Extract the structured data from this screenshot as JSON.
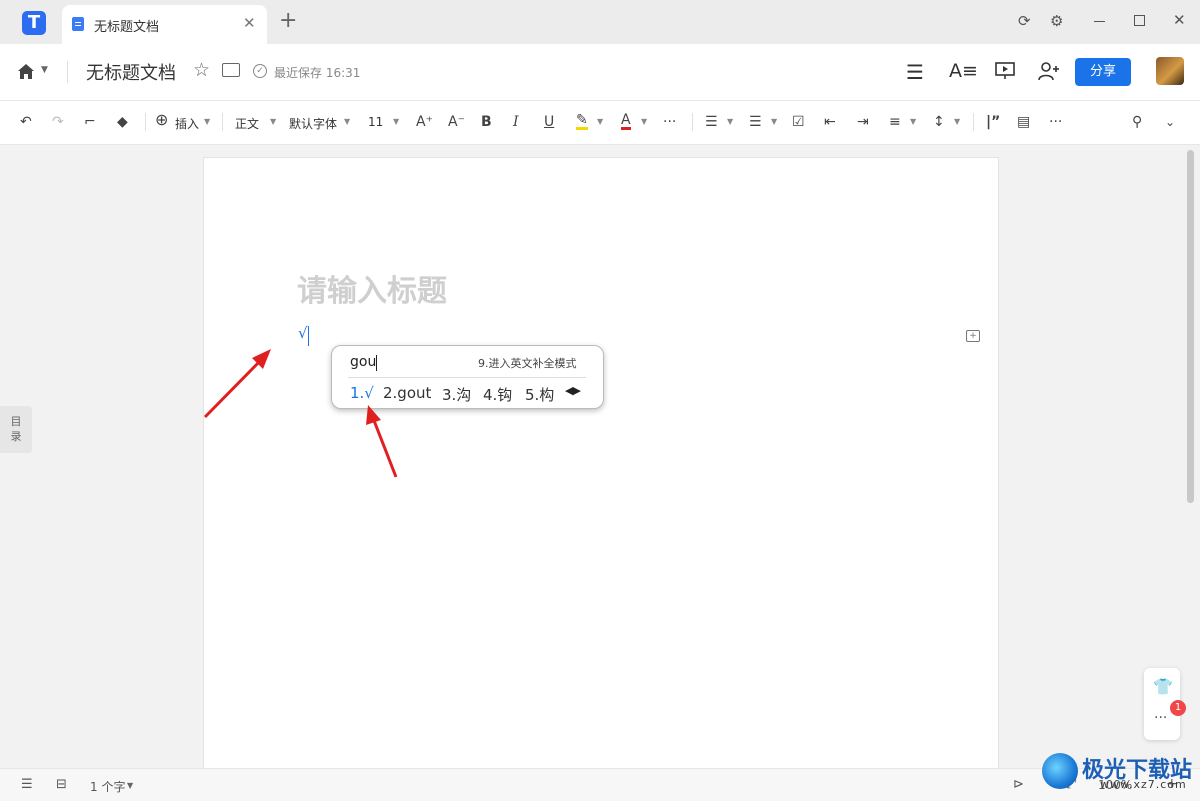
{
  "titlebar": {
    "tab_title": "无标题文档",
    "tab_close": "✕",
    "new_tab": "+"
  },
  "header": {
    "doc_title": "无标题文档",
    "save_status": "最近保存 16:31",
    "share_label": "分享"
  },
  "toolbar": {
    "insert_label": "插入",
    "style_label": "正文",
    "font_label": "默认字体",
    "size_label": "11",
    "more": "···"
  },
  "editor": {
    "title_placeholder": "请输入标题",
    "typed_char": "√"
  },
  "ime": {
    "input": "gou",
    "hint": "9.进入英文补全模式",
    "candidates": [
      "1.√",
      "2.gout",
      "3.沟",
      "4.钩",
      "5.构"
    ],
    "candidate_selected_color": "#1a73e8"
  },
  "sidebar": {
    "toc_label_1": "目",
    "toc_label_2": "录"
  },
  "floating": {
    "notification_count": "1",
    "more": "···"
  },
  "statusbar": {
    "word_count": "1 个字",
    "zoom": "100%"
  },
  "watermark": {
    "name": "极光下载站",
    "url": "www.xz7.com"
  },
  "colors": {
    "accent": "#1a73e8",
    "annotation_arrow": "#e02020"
  }
}
